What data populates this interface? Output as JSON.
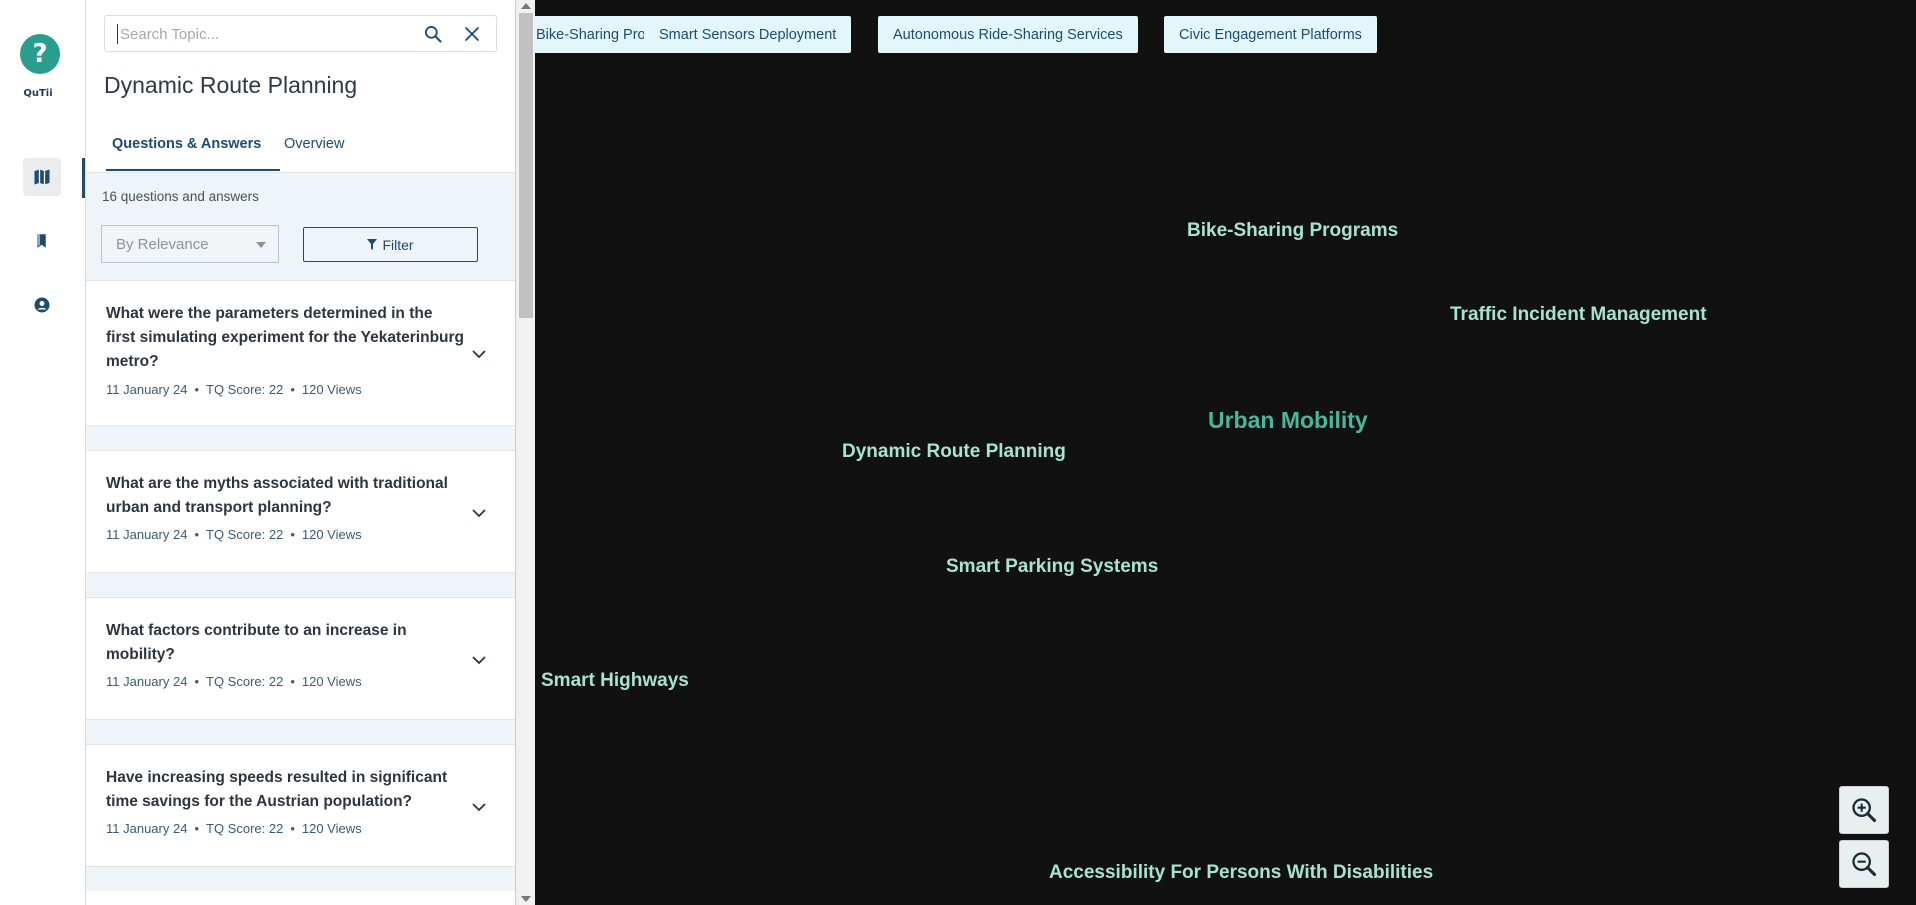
{
  "app": {
    "logo_glyph": "?",
    "logo_text": "QuTii"
  },
  "rail": {
    "items": [
      {
        "name": "map-icon",
        "active": true
      },
      {
        "name": "bookmark-icon",
        "active": false
      },
      {
        "name": "account-icon",
        "active": false
      }
    ]
  },
  "search": {
    "placeholder": "Search Topic...",
    "value": ""
  },
  "topic": {
    "title": "Dynamic Route Planning"
  },
  "tabs": [
    {
      "label": "Questions & Answers",
      "active": true
    },
    {
      "label": "Overview",
      "active": false
    }
  ],
  "qa": {
    "count_text": "16 questions and answers",
    "sort_value": "By Relevance",
    "filter_label": "Filter",
    "items": [
      {
        "question": "What were the parameters determined in the first simulating experiment for the Yekaterinburg metro?",
        "date": "11 January 24",
        "score": "TQ Score: 22",
        "views": "120 Views"
      },
      {
        "question": "What are the myths associated with traditional urban and transport planning?",
        "date": "11 January 24",
        "score": "TQ Score: 22",
        "views": "120 Views"
      },
      {
        "question": "What factors contribute to an increase in mobility?",
        "date": "11 January 24",
        "score": "TQ Score: 22",
        "views": "120 Views"
      },
      {
        "question": "Have increasing speeds resulted in significant time savings for the Austrian population?",
        "date": "11 January 24",
        "score": "TQ Score: 22",
        "views": "120 Views"
      }
    ]
  },
  "canvas": {
    "chips": [
      "Bike-Sharing Programs",
      "Smart Sensors Deployment",
      "Autonomous Ride-Sharing Services",
      "Civic Engagement Platforms"
    ],
    "nodes": {
      "center": "Urban Mobility",
      "bike_sharing": "Bike-Sharing Programs",
      "traffic_incident": "Traffic Incident Management",
      "dynamic_route": "Dynamic Route Planning",
      "smart_parking": "Smart Parking Systems",
      "smart_highways": "Smart Highways",
      "accessibility": "Accessibility For Persons With Disabilities"
    },
    "zoom_in": "zoom-in-icon",
    "zoom_out": "zoom-out-icon"
  },
  "colors": {
    "canvas_bg": "#111111",
    "node_text": "#a8e3cf",
    "center_node": "#4cb59a",
    "chip_bg": "#e3f6fb",
    "primary": "#1f4b6e"
  }
}
